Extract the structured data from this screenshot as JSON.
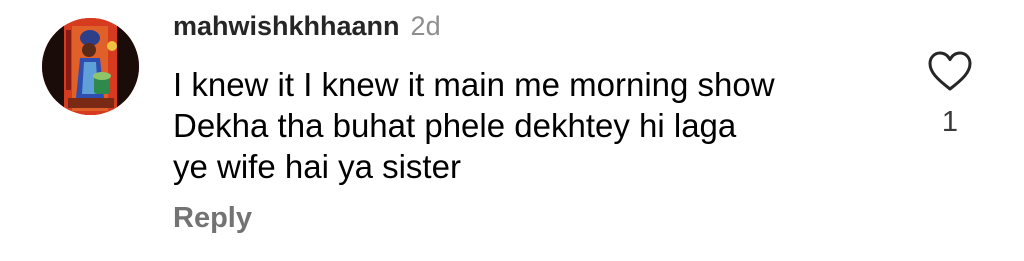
{
  "comment": {
    "username": "mahwishkhhaann",
    "timestamp": "2d",
    "text_lines": [
      "I knew it I knew it main me morning show",
      "Dekha tha buhat phele dekhtey hi laga",
      "ye wife hai ya sister"
    ],
    "reply_label": "Reply",
    "like_count": "1",
    "like_icon": "heart-outline-icon",
    "avatar_icon": "avatar-artwork",
    "colors": {
      "username": "#262626",
      "timestamp": "#8e8e8e",
      "reply": "#737373",
      "heart_stroke": "#262626"
    }
  }
}
